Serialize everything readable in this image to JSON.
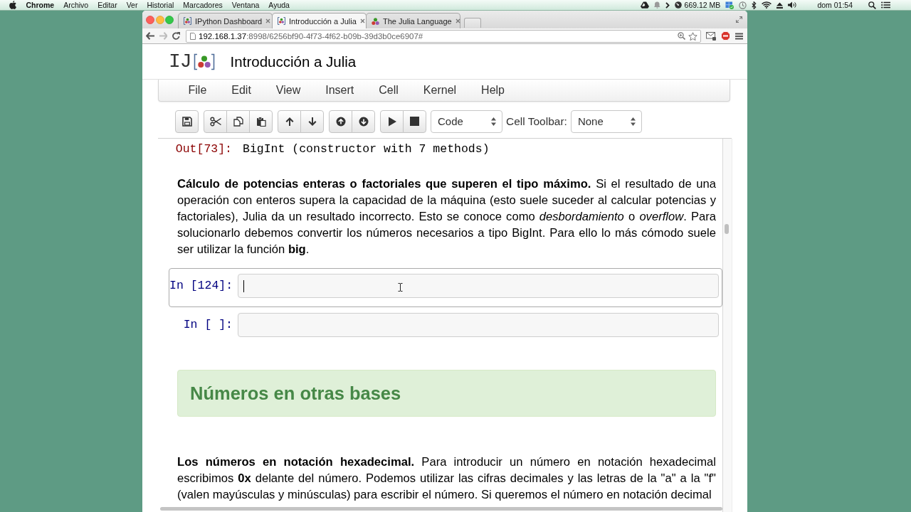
{
  "menubar": {
    "app": "Chrome",
    "menus": [
      "Archivo",
      "Editar",
      "Ver",
      "Historial",
      "Marcadores",
      "Ventana",
      "Ayuda"
    ],
    "memory": "669.12 MB",
    "clock": "dom 01:54"
  },
  "browser": {
    "tabs": [
      {
        "title": "IPython Dashboard",
        "kind": "notebook",
        "selected": false
      },
      {
        "title": "Introducción a Julia",
        "kind": "notebook",
        "selected": true
      },
      {
        "title": "The Julia Language",
        "kind": "website",
        "selected": false
      }
    ],
    "address": {
      "host": "192.168.1.37",
      "path": ":8998/6256bf90-4f73-4f62-b09b-39d3b0ce6907#"
    }
  },
  "notebook": {
    "logo": "IJ",
    "title": "Introducción a Julia",
    "menus": [
      "File",
      "Edit",
      "View",
      "Insert",
      "Cell",
      "Kernel",
      "Help"
    ],
    "toolbar": {
      "cell_type": "Code",
      "cell_toolbar_label": "Cell Toolbar:",
      "cell_toolbar": "None"
    },
    "cells": [
      {
        "kind": "output",
        "prompt": "Out[73]:",
        "text": "BigInt (constructor with 7 methods)"
      },
      {
        "kind": "markdown",
        "text": "**Cálculo de potencias enteras o factoriales que superen el tipo máximo.** Si el resultado de una operación con enteros supera la capacidad de la máquina (esto suele suceder al calcular potencias y factoriales), Julia da un resultado incorrecto. Esto se conoce como *desbordamiento* o *overflow*. Para solucionarlo debemos convertir los números necesarios a tipo BigInt. Para ello lo más cómodo suele ser utilizar la función **big**."
      },
      {
        "kind": "code",
        "prompt": "In [124]:",
        "selected": true
      },
      {
        "kind": "code",
        "prompt": "In [ ]:",
        "selected": false
      },
      {
        "kind": "heading",
        "text": "Números en otras bases"
      },
      {
        "kind": "markdown",
        "text": "**Los números en notación hexadecimal.** Para introducir un número en notación hexadecimal escribimos **0x** delante del número. Podemos utilizar las cifras decimales y las letras de la \"a\" a la \"f\" (valen mayúsculas y minúsculas) para escribir el número. Si queremos el número en notación decimal"
      }
    ]
  }
}
